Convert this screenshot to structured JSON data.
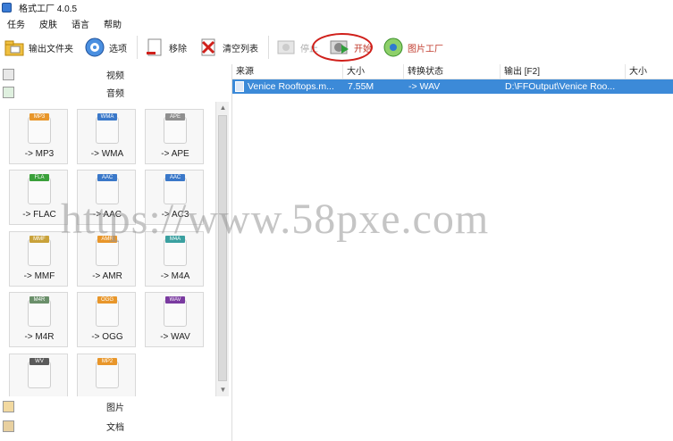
{
  "window": {
    "title": "格式工厂 4.0.5"
  },
  "menu": [
    "任务",
    "皮肤",
    "语言",
    "帮助"
  ],
  "toolbar": {
    "output_folder": "输出文件夹",
    "options": "选项",
    "remove": "移除",
    "clear_list": "清空列表",
    "stop": "停止",
    "start": "开始",
    "picture_factory": "图片工厂"
  },
  "sidebar": {
    "video": "视频",
    "audio": "音频",
    "picture": "图片",
    "document": "文档"
  },
  "formats": [
    {
      "tag": "MP3",
      "label": "-> MP3",
      "color": "#e8962a"
    },
    {
      "tag": "WMA",
      "label": "-> WMA",
      "color": "#3a78c9"
    },
    {
      "tag": "APE",
      "label": "-> APE",
      "color": "#8f8f8f"
    },
    {
      "tag": "FLA",
      "label": "-> FLAC",
      "color": "#3aa03a"
    },
    {
      "tag": "AAC",
      "label": "-> AAC",
      "color": "#3a78c9"
    },
    {
      "tag": "AAC",
      "label": "-> AC3",
      "color": "#3a78c9"
    },
    {
      "tag": "MMF",
      "label": "-> MMF",
      "color": "#c9a23a"
    },
    {
      "tag": "AMR",
      "label": "-> AMR",
      "color": "#e8962a"
    },
    {
      "tag": "M4A",
      "label": "-> M4A",
      "color": "#3aa0a0"
    },
    {
      "tag": "M4R",
      "label": "-> M4R",
      "color": "#6a8f6a"
    },
    {
      "tag": "OGG",
      "label": "-> OGG",
      "color": "#e8962a"
    },
    {
      "tag": "WAV",
      "label": "-> WAV",
      "color": "#7a3aa0"
    },
    {
      "tag": "WV",
      "label": "",
      "color": "#5a5a5a"
    },
    {
      "tag": "MP2",
      "label": "",
      "color": "#e8962a"
    }
  ],
  "table": {
    "columns": [
      "来源",
      "大小",
      "转换状态",
      "输出 [F2]",
      "大小"
    ],
    "rows": [
      {
        "source": "Venice Rooftops.m...",
        "size": "7.55M",
        "status": "-> WAV",
        "output": "D:\\FFOutput\\Venice Roo...",
        "out_size": ""
      }
    ]
  },
  "watermark": "https://www.58pxe.com"
}
